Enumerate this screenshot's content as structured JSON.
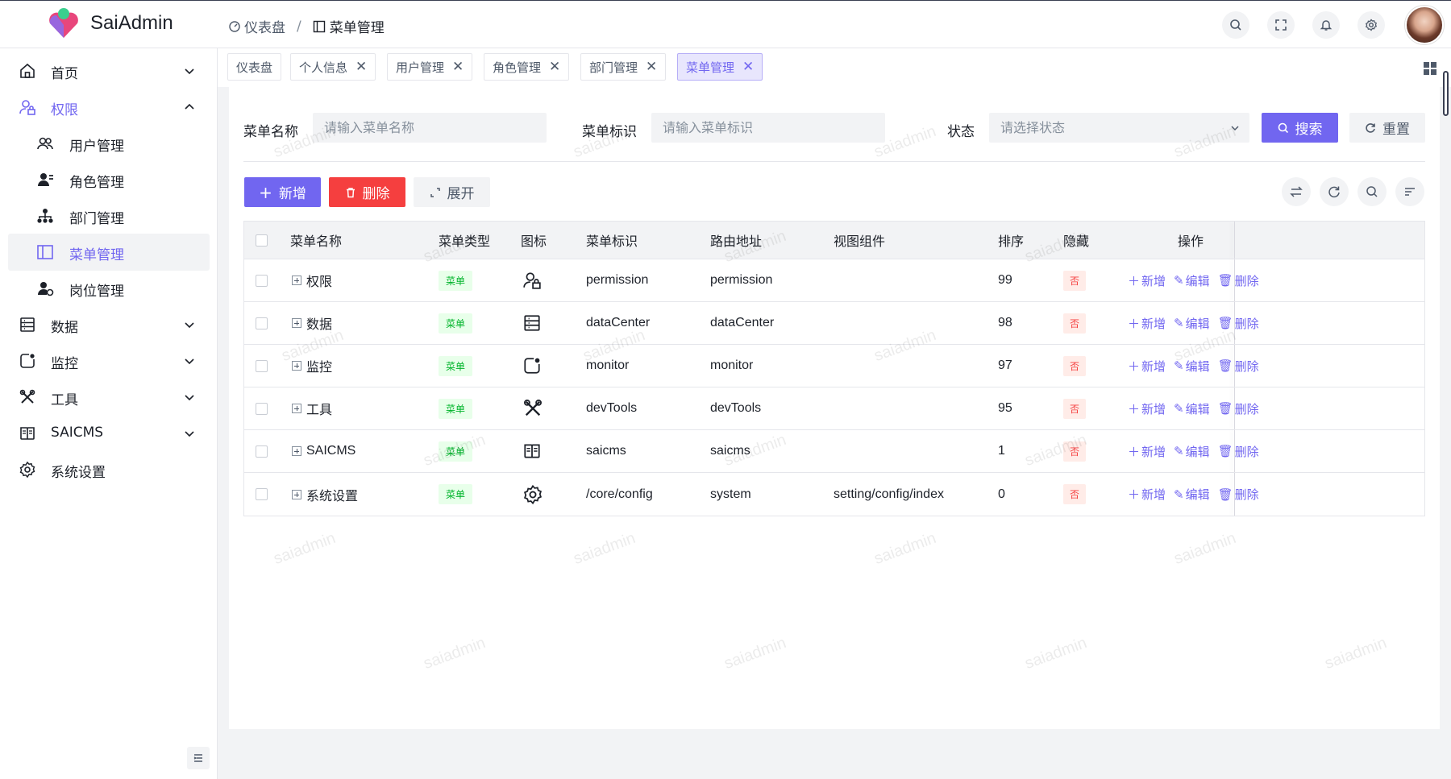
{
  "app": {
    "brand": "SaiAdmin"
  },
  "breadcrumb": [
    {
      "label": "仪表盘",
      "icon": "dashboard-icon"
    },
    {
      "label": "菜单管理",
      "icon": "menu-icon"
    }
  ],
  "sidebar": {
    "items": [
      {
        "label": "首页",
        "icon": "home-icon",
        "chevron": "down"
      },
      {
        "label": "权限",
        "icon": "user-lock-icon",
        "chevron": "up"
      },
      {
        "label": "用户管理",
        "icon": "users-icon"
      },
      {
        "label": "角色管理",
        "icon": "user-role-icon"
      },
      {
        "label": "部门管理",
        "icon": "org-tree-icon"
      },
      {
        "label": "菜单管理",
        "icon": "menu-layout-icon"
      },
      {
        "label": "岗位管理",
        "icon": "user-post-icon"
      },
      {
        "label": "数据",
        "icon": "database-icon",
        "chevron": "down"
      },
      {
        "label": "监控",
        "icon": "monitor-icon",
        "chevron": "down"
      },
      {
        "label": "工具",
        "icon": "tools-icon",
        "chevron": "down"
      },
      {
        "label": "SAICMS",
        "icon": "book-icon",
        "chevron": "down"
      },
      {
        "label": "系统设置",
        "icon": "gear-icon"
      }
    ]
  },
  "tabs": [
    {
      "label": "仪表盘",
      "closable": false
    },
    {
      "label": "个人信息",
      "closable": true
    },
    {
      "label": "用户管理",
      "closable": true
    },
    {
      "label": "角色管理",
      "closable": true
    },
    {
      "label": "部门管理",
      "closable": true
    },
    {
      "label": "菜单管理",
      "closable": true
    }
  ],
  "search": {
    "name_label": "菜单名称",
    "name_placeholder": "请输入菜单名称",
    "code_label": "菜单标识",
    "code_placeholder": "请输入菜单标识",
    "status_label": "状态",
    "status_placeholder": "请选择状态",
    "search_button": "搜索",
    "reset_button": "重置"
  },
  "toolbar": {
    "add": "新增",
    "delete": "删除",
    "expand": "展开"
  },
  "table": {
    "columns": [
      "菜单名称",
      "菜单类型",
      "图标",
      "菜单标识",
      "路由地址",
      "视图组件",
      "排序",
      "隐藏",
      "操作"
    ],
    "rows": [
      {
        "name": "权限",
        "type": "菜单",
        "icon": "user-lock-icon",
        "code": "permission",
        "route": "permission",
        "component": "",
        "sort": "99",
        "hidden": "否"
      },
      {
        "name": "数据",
        "type": "菜单",
        "icon": "database-icon",
        "code": "dataCenter",
        "route": "dataCenter",
        "component": "",
        "sort": "98",
        "hidden": "否"
      },
      {
        "name": "监控",
        "type": "菜单",
        "icon": "monitor-icon",
        "code": "monitor",
        "route": "monitor",
        "component": "",
        "sort": "97",
        "hidden": "否"
      },
      {
        "name": "工具",
        "type": "菜单",
        "icon": "tools-icon",
        "code": "devTools",
        "route": "devTools",
        "component": "",
        "sort": "95",
        "hidden": "否"
      },
      {
        "name": "SAICMS",
        "type": "菜单",
        "icon": "book-icon",
        "code": "saicms",
        "route": "saicms",
        "component": "",
        "sort": "1",
        "hidden": "否"
      },
      {
        "name": "系统设置",
        "type": "菜单",
        "icon": "gear-icon",
        "code": "/core/config",
        "route": "system",
        "component": "setting/config/index",
        "sort": "0",
        "hidden": "否"
      }
    ],
    "ops": {
      "add": "新增",
      "edit": "编辑",
      "delete": "删除"
    }
  },
  "watermark": "saiadmin",
  "colors": {
    "primary": "#7166f0",
    "danger": "#f53f3f",
    "success": "#00b42a"
  }
}
